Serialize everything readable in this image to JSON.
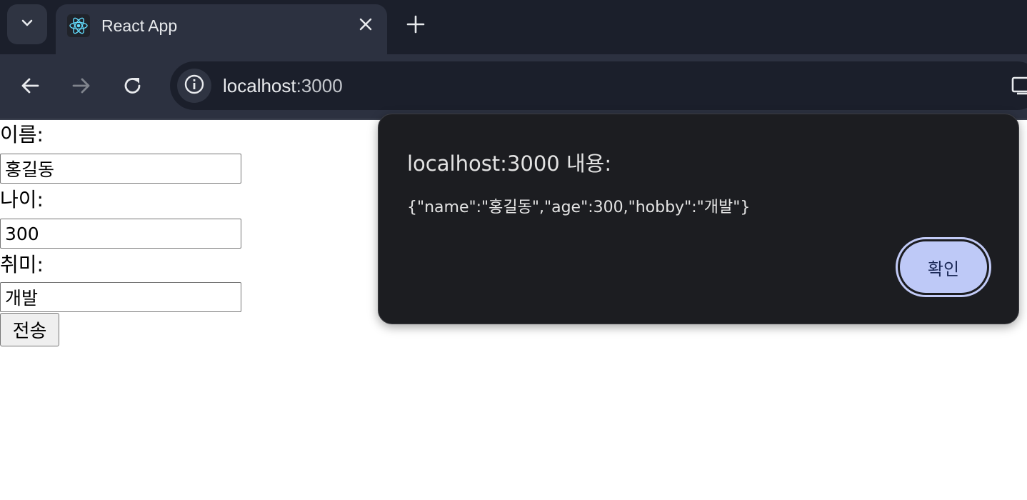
{
  "browser": {
    "tab": {
      "title": "React App",
      "favicon": "react-logo-icon"
    },
    "tab_search_icon": "chevron-down-icon",
    "new_tab_icon": "plus-icon",
    "close_tab_icon": "close-icon",
    "nav": {
      "back_icon": "arrow-left-icon",
      "forward_icon": "arrow-right-icon",
      "reload_icon": "reload-icon"
    },
    "address_bar": {
      "site_info_icon": "info-icon",
      "host": "localhost",
      "port": ":3000"
    },
    "colors": {
      "tabstrip": "#1b1f2b",
      "toolbar": "#2c3140",
      "omnibox": "#1b1f2b"
    }
  },
  "form": {
    "name_label": "이름:",
    "name_value": "홍길동",
    "age_label": "나이:",
    "age_value": "300",
    "hobby_label": "취미:",
    "hobby_value": "개발",
    "submit_label": "전송"
  },
  "alert": {
    "title": "localhost:3000 내용:",
    "message": "{\"name\":\"홍길동\",\"age\":300,\"hobby\":\"개발\"}",
    "ok_label": "확인",
    "colors": {
      "background": "#1c1d21",
      "button": "#bec9f7"
    }
  }
}
